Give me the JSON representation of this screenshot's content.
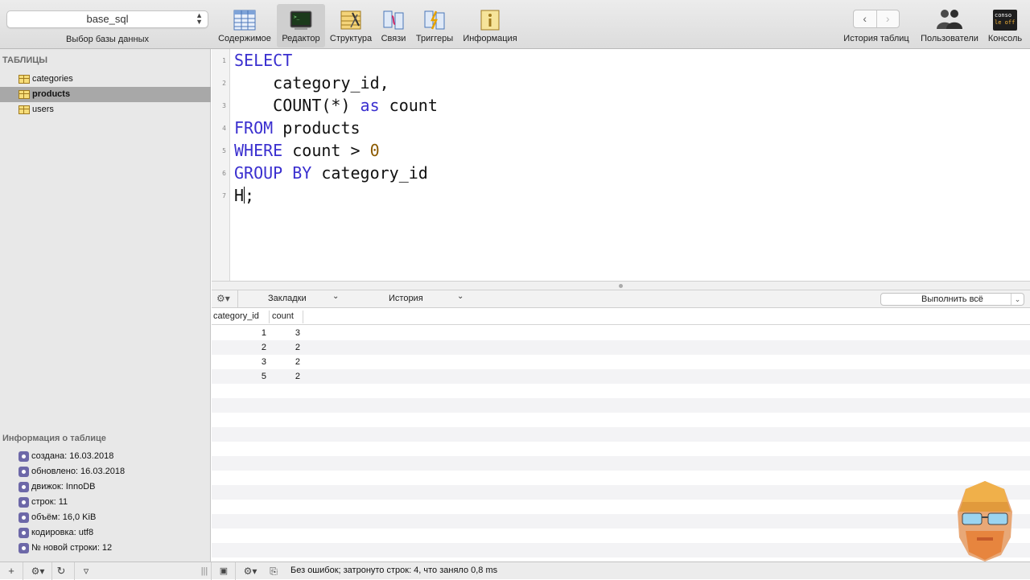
{
  "toolbar": {
    "db_select_value": "base_sql",
    "db_select_label": "Выбор базы данных",
    "buttons": {
      "content": "Содержимое",
      "editor": "Редактор",
      "structure": "Структура",
      "relations": "Связи",
      "triggers": "Триггеры",
      "info": "Информация",
      "table_history": "История таблиц",
      "users": "Пользователи",
      "console": "Консоль"
    },
    "console_icon_text": [
      "conso",
      "le off"
    ]
  },
  "sidebar": {
    "tables_header": "ТАБЛИЦЫ",
    "tables": [
      {
        "name": "categories",
        "selected": false
      },
      {
        "name": "products",
        "selected": true
      },
      {
        "name": "users",
        "selected": false
      }
    ],
    "info_header": "Информация о таблице",
    "info_items": [
      "создана: 16.03.2018",
      "обновлено: 16.03.2018",
      "движок: InnoDB",
      "строк: 11",
      "объём: 16,0 KiB",
      "кодировка: utf8",
      "№ новой строки: 12"
    ]
  },
  "editor": {
    "line_numbers": [
      "1",
      "2",
      "3",
      "4",
      "5",
      "6",
      "7"
    ],
    "lines": [
      [
        {
          "t": "SELECT",
          "k": "kw"
        }
      ],
      [
        {
          "t": "    category_id,",
          "k": ""
        }
      ],
      [
        {
          "t": "    COUNT(*) ",
          "k": ""
        },
        {
          "t": "as",
          "k": "kw"
        },
        {
          "t": " count",
          "k": ""
        }
      ],
      [
        {
          "t": "FROM",
          "k": "kw"
        },
        {
          "t": " products",
          "k": ""
        }
      ],
      [
        {
          "t": "WHERE",
          "k": "kw"
        },
        {
          "t": " count > ",
          "k": ""
        },
        {
          "t": "0",
          "k": "num"
        }
      ],
      [
        {
          "t": "GROUP BY",
          "k": "kw"
        },
        {
          "t": " category_id",
          "k": ""
        }
      ],
      [
        {
          "t": "H",
          "k": ""
        },
        {
          "t": "|",
          "k": "caret"
        },
        {
          "t": ";",
          "k": ""
        }
      ]
    ]
  },
  "query_bar": {
    "bookmarks": "Закладки",
    "history": "История",
    "run_all": "Выполнить всё"
  },
  "results": {
    "columns": [
      "category_id",
      "count"
    ],
    "rows": [
      [
        "1",
        "3"
      ],
      [
        "2",
        "2"
      ],
      [
        "3",
        "2"
      ],
      [
        "5",
        "2"
      ]
    ]
  },
  "status": {
    "text": "Без ошибок; затронуто строк: 4, что заняло 0,8 ms"
  },
  "colors": {
    "keyword": "#3a2fcf",
    "number": "#8b5a00",
    "selected_row": "#a8a8a8",
    "info_icon": "#6d68a8"
  }
}
